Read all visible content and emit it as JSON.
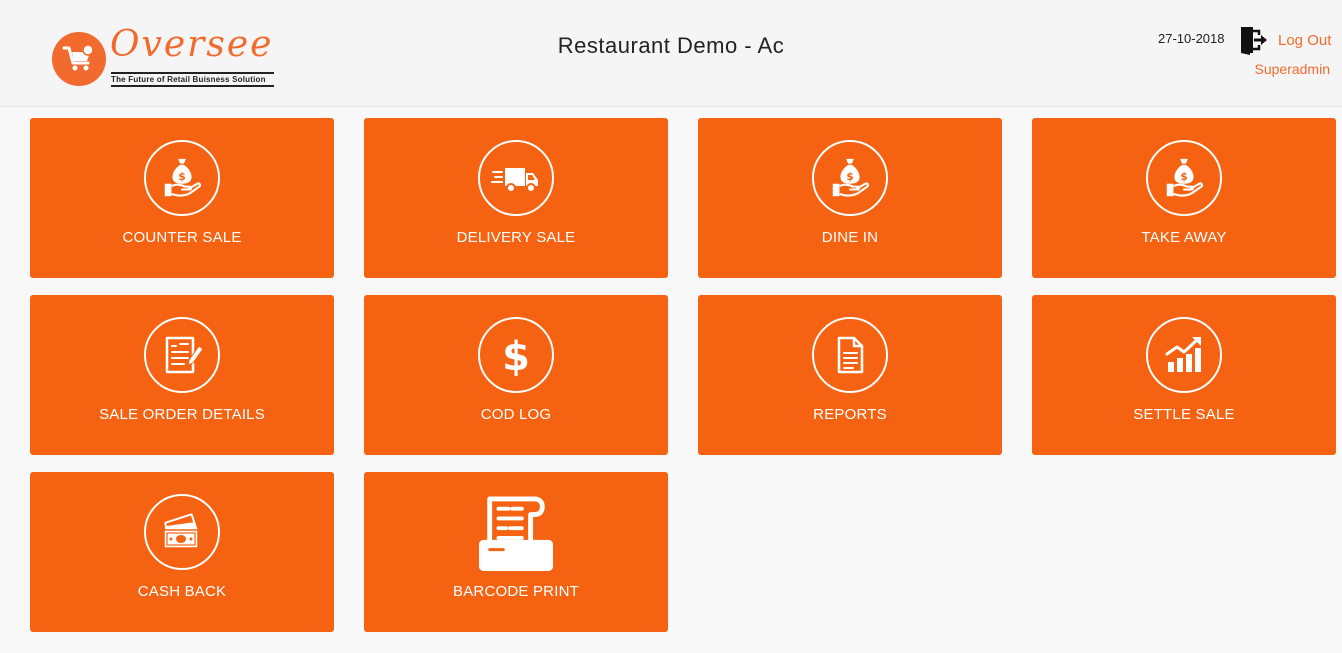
{
  "header": {
    "logo": {
      "name": "Oversee",
      "tagline": "The Future of Retail Buisness Solution"
    },
    "title": "Restaurant Demo - Ac",
    "date": "27-10-2018",
    "logout_label": "Log Out",
    "user": "Superadmin"
  },
  "colors": {
    "accent": "#f26a2e",
    "tile": "#f56312",
    "header_bg": "#f5f5f5",
    "page_bg": "#f8f8f8"
  },
  "tiles": [
    {
      "label": "COUNTER SALE",
      "icon": "money-bag-hand-icon"
    },
    {
      "label": "DELIVERY SALE",
      "icon": "delivery-truck-icon"
    },
    {
      "label": "DINE IN",
      "icon": "money-bag-hand-icon"
    },
    {
      "label": "TAKE AWAY",
      "icon": "money-bag-hand-icon"
    },
    {
      "label": "SALE ORDER DETAILS",
      "icon": "document-edit-icon"
    },
    {
      "label": "COD LOG",
      "icon": "dollar-icon"
    },
    {
      "label": "REPORTS",
      "icon": "report-file-icon"
    },
    {
      "label": "SETTLE SALE",
      "icon": "growth-chart-icon"
    },
    {
      "label": "CASH BACK",
      "icon": "cash-notes-icon"
    },
    {
      "label": "BARCODE PRINT",
      "icon": "barcode-printer-icon"
    }
  ]
}
